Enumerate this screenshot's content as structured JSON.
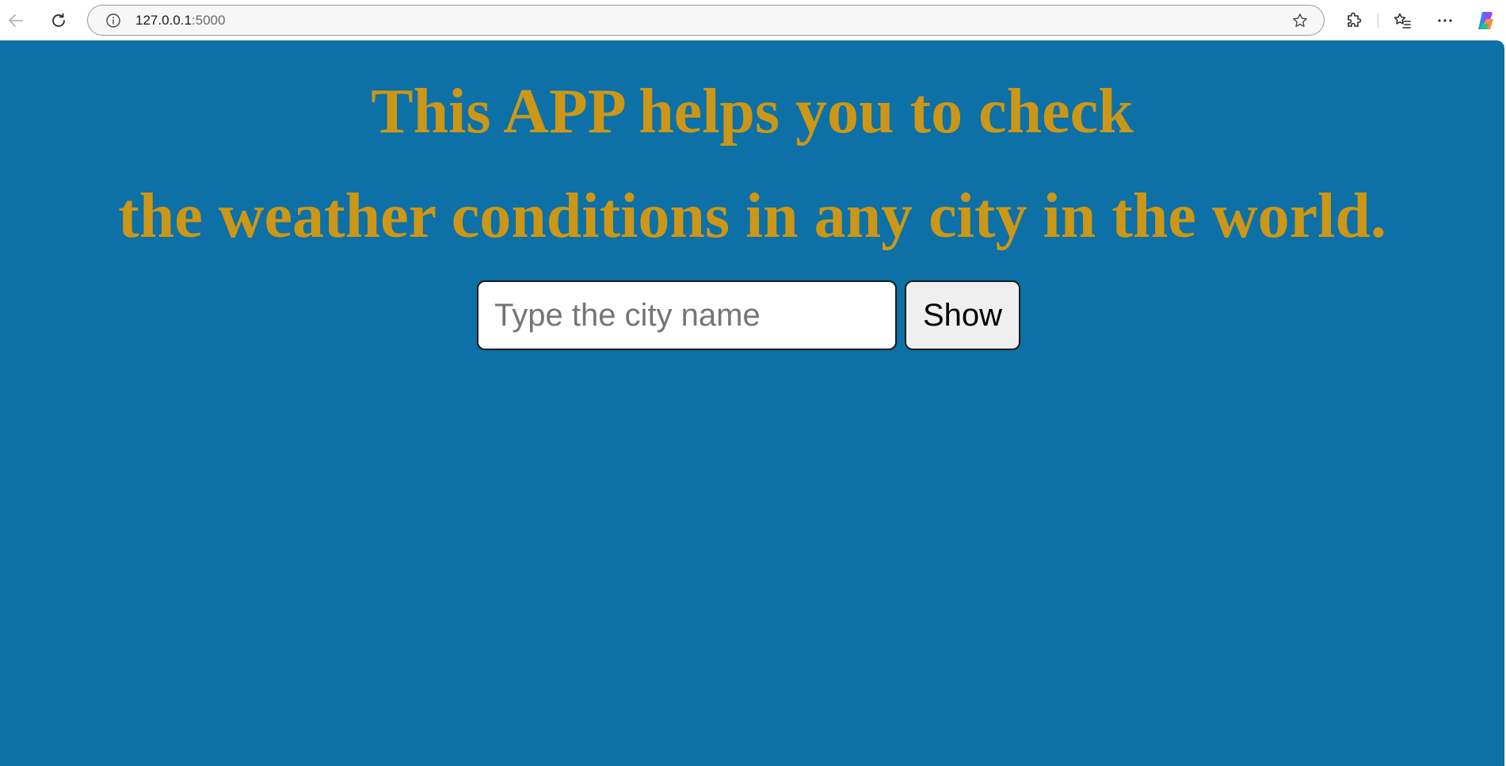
{
  "browser": {
    "address": {
      "host": "127.0.0.1",
      "port": ":5000"
    },
    "icons": {
      "back": "back-arrow-icon",
      "reload": "reload-icon",
      "info": "info-icon",
      "favorite": "star-icon",
      "extensions": "puzzle-icon",
      "favorites": "favorites-list-icon",
      "more": "more-dots-icon",
      "copilot": "copilot-icon"
    }
  },
  "page": {
    "heading_line1": "This APP helps you to check",
    "heading_line2": "the weather conditions in any city in the world.",
    "search": {
      "placeholder": "Type the city name",
      "value": "",
      "button_label": "Show"
    }
  },
  "colors": {
    "background": "#0d70a6",
    "heading": "#cc9716"
  }
}
